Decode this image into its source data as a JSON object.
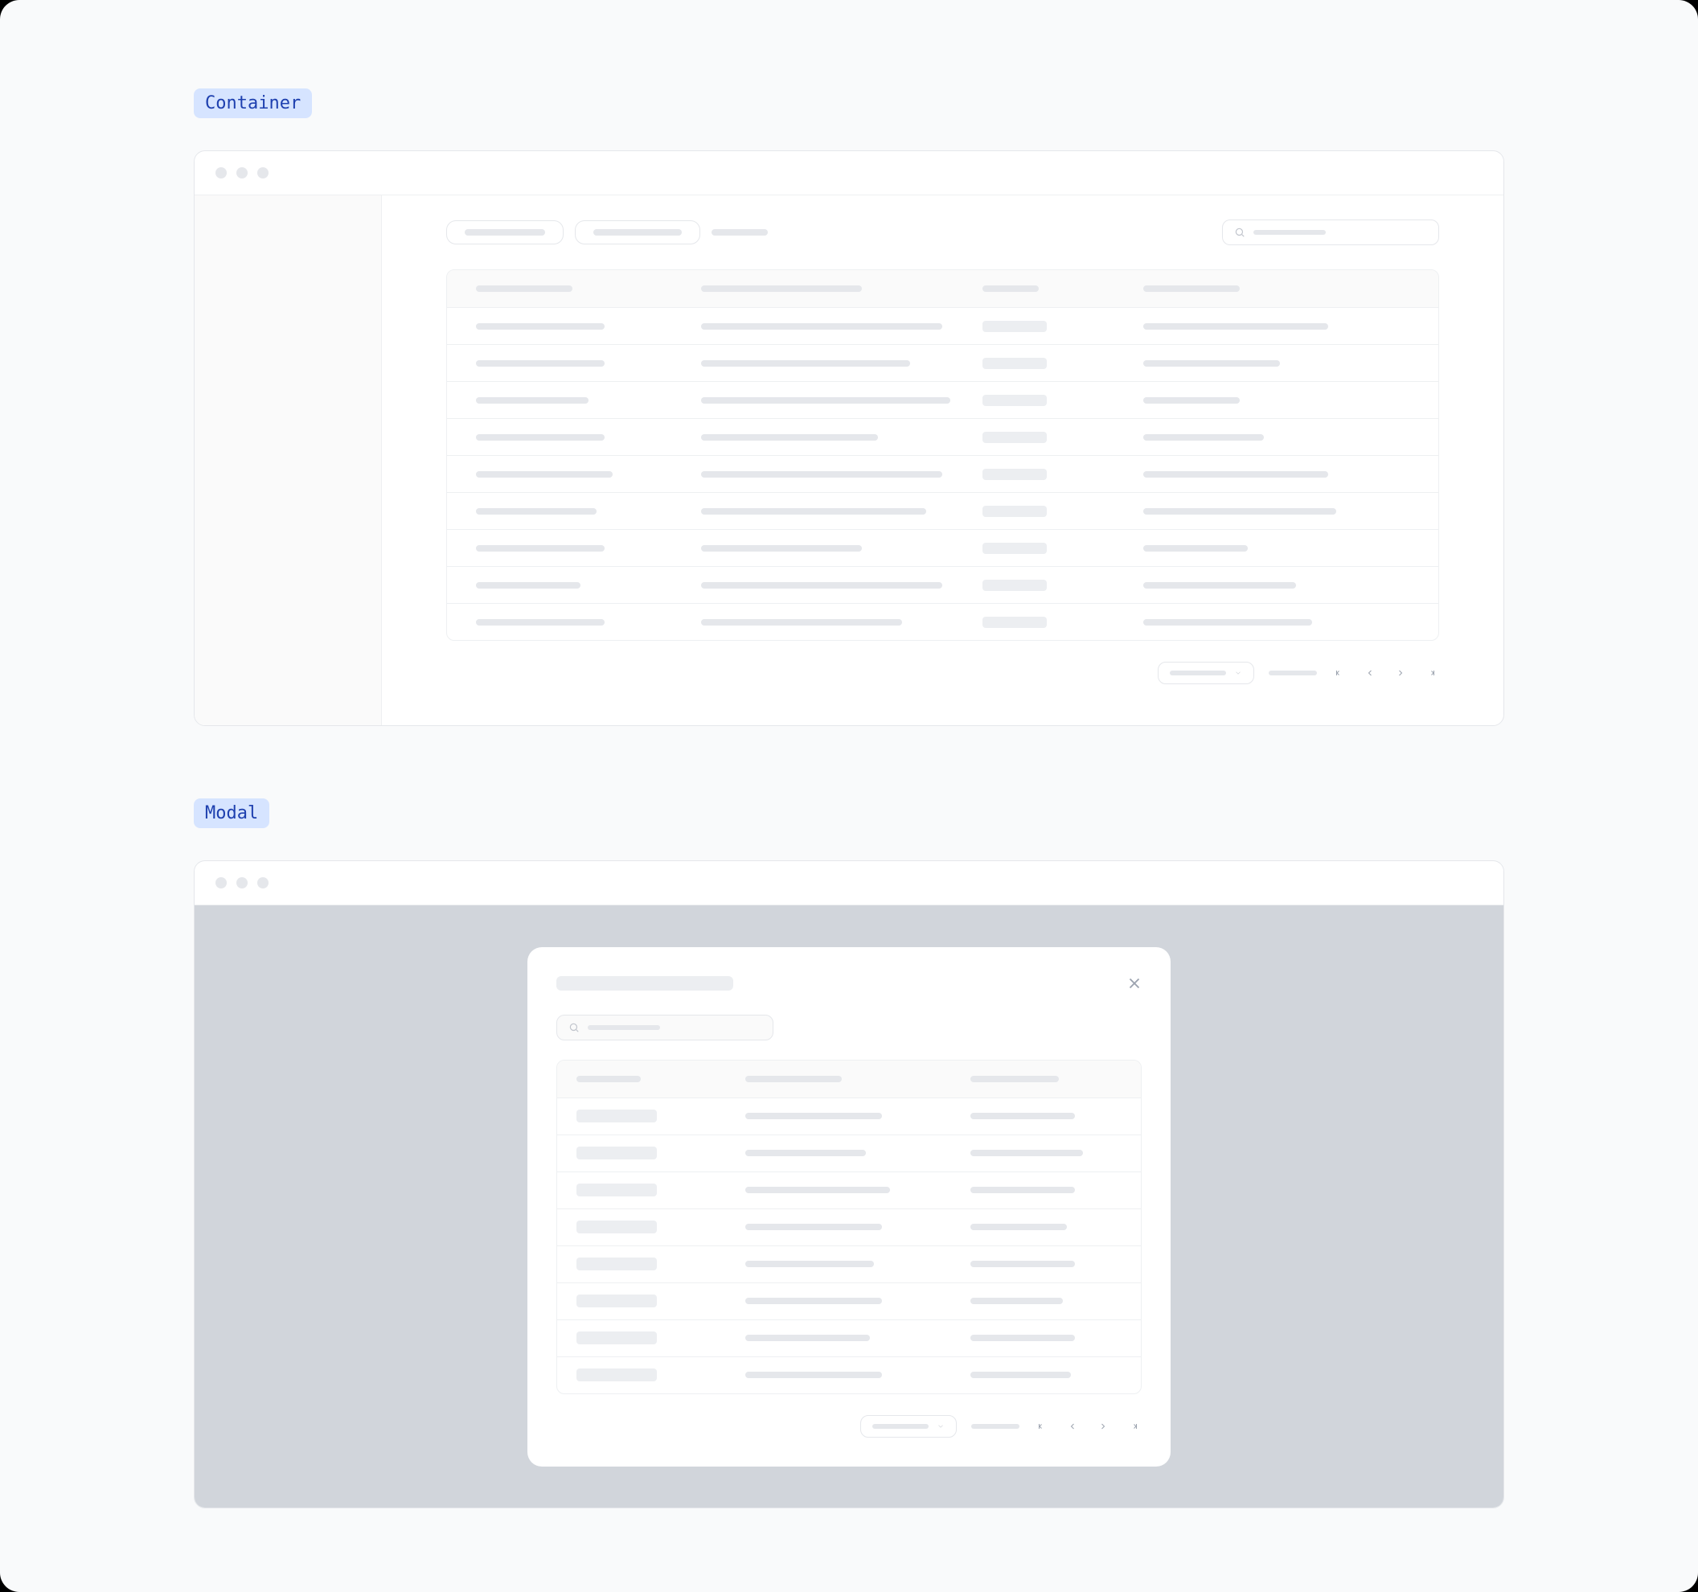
{
  "sections": [
    {
      "label": "Container"
    },
    {
      "label": "Modal"
    }
  ],
  "container": {
    "toolbar": {
      "pill1": "",
      "pill2": "",
      "ghost": "",
      "search_placeholder": ""
    },
    "table": {
      "rows": 10
    },
    "pagination": {
      "select": "",
      "text": ""
    }
  },
  "modal": {
    "title": "",
    "search_placeholder": "",
    "table": {
      "rows": 9
    },
    "pagination": {
      "select": "",
      "text": ""
    }
  }
}
